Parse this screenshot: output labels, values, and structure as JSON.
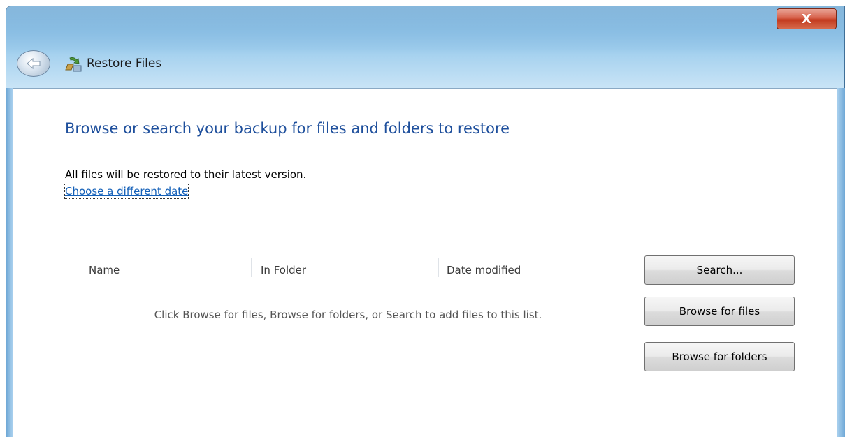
{
  "window": {
    "title": "Restore Files",
    "close_label": "X"
  },
  "main": {
    "headline": "Browse or search your backup for files and folders to restore",
    "info": "All files will be restored to their latest version.",
    "link": "Choose a different date"
  },
  "list": {
    "columns": [
      "Name",
      "In Folder",
      "Date modified"
    ],
    "empty_message": "Click Browse for files, Browse for folders, or Search to add files to this list."
  },
  "buttons": {
    "search": "Search...",
    "browse_files": "Browse for files",
    "browse_folders": "Browse for folders"
  },
  "icons": {
    "back": "back-arrow-icon",
    "title": "restore-files-icon",
    "close": "close-icon"
  },
  "colors": {
    "headline": "#1e4f9c",
    "link": "#1460b8",
    "close_button": "#c23a1e",
    "frame": "#7cb6e0"
  }
}
